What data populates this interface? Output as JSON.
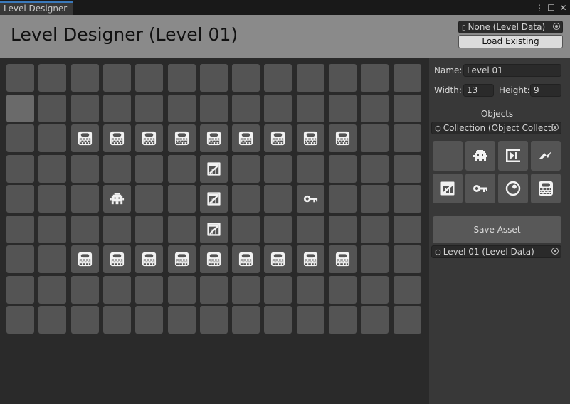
{
  "window": {
    "tab_title": "Level Designer",
    "controls": [
      "more-options-icon",
      "maximize-icon",
      "close-icon"
    ]
  },
  "header": {
    "title": "Level Designer (Level 01)",
    "level_data_field": "None (Level Data)",
    "load_button": "Load Existing"
  },
  "grid": {
    "rows": [
      [
        "",
        "",
        "",
        "",
        "",
        "",
        "",
        "",
        "",
        "",
        "",
        "",
        ""
      ],
      [
        "",
        "",
        "",
        "",
        "",
        "",
        "",
        "",
        "",
        "",
        "",
        "",
        ""
      ],
      [
        "",
        "",
        "wall",
        "wall",
        "wall",
        "wall",
        "wall",
        "wall",
        "wall",
        "wall",
        "wall",
        "",
        ""
      ],
      [
        "",
        "",
        "",
        "",
        "",
        "",
        "crate",
        "",
        "",
        "",
        "",
        "",
        ""
      ],
      [
        "",
        "",
        "",
        "enemy",
        "",
        "",
        "crate",
        "",
        "",
        "key",
        "",
        "",
        ""
      ],
      [
        "",
        "",
        "",
        "",
        "",
        "",
        "crate",
        "",
        "",
        "",
        "",
        "",
        ""
      ],
      [
        "",
        "",
        "wall",
        "wall",
        "wall",
        "wall",
        "wall",
        "wall",
        "wall",
        "wall",
        "wall",
        "",
        ""
      ],
      [
        "",
        "",
        "",
        "",
        "",
        "",
        "",
        "",
        "",
        "",
        "",
        "",
        ""
      ],
      [
        "",
        "",
        "",
        "",
        "",
        "",
        "",
        "",
        "",
        "",
        "",
        "",
        ""
      ]
    ],
    "highlighted_cell": {
      "row": 1,
      "col": 0
    }
  },
  "sidebar": {
    "name_label": "Name:",
    "name_value": "Level 01",
    "width_label": "Width:",
    "width_value": "13",
    "height_label": "Height:",
    "height_value": "9",
    "objects_label": "Objects",
    "collection_field": "Collection (Object Collecti",
    "palette": [
      "",
      "enemy",
      "exit",
      "spark",
      "crate",
      "key",
      "orb",
      "wall"
    ],
    "save_button": "Save Asset",
    "asset_field": "Level 01 (Level Data)"
  },
  "colors": {
    "panel_bg": "#383838",
    "grid_bg": "#2a2a2a",
    "cell": "#545454",
    "header_bg": "#8a8a8a",
    "tab_accent": "#3a79bb"
  }
}
